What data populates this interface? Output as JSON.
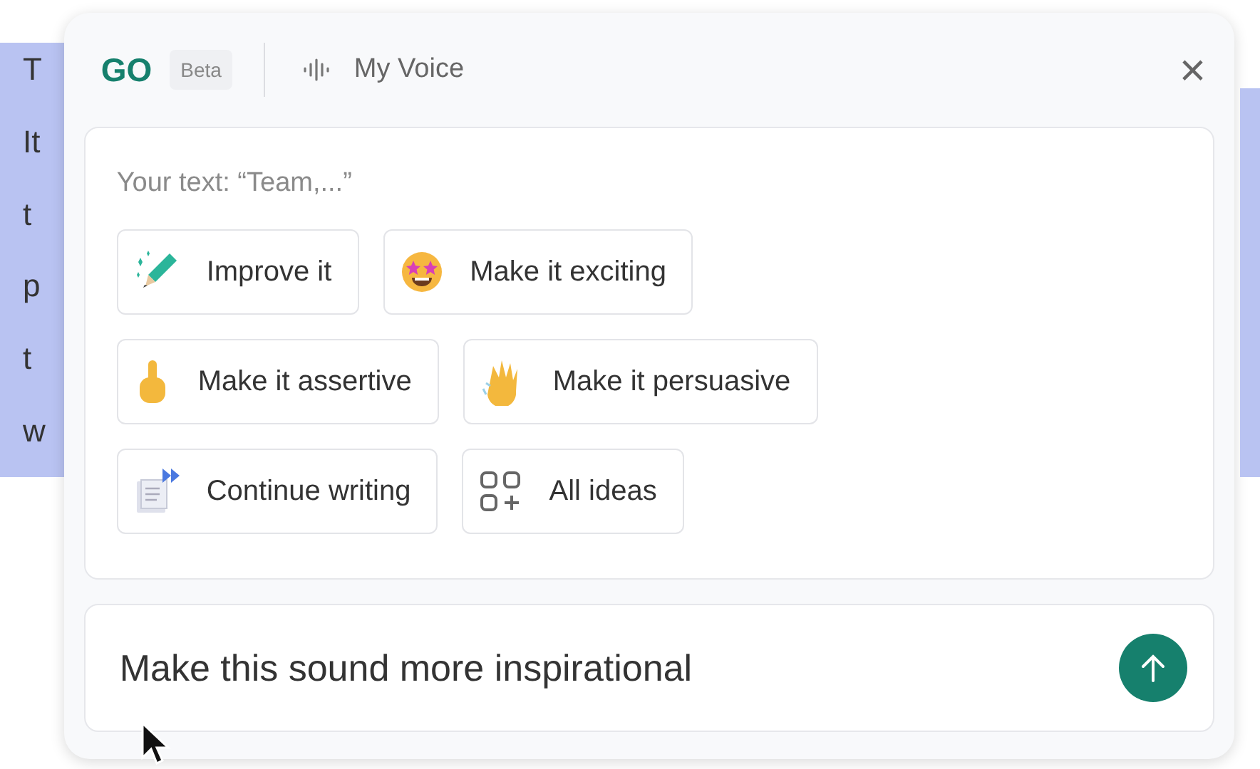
{
  "document": {
    "lines": [
      "T",
      "It",
      "t",
      "p",
      "t",
      "w"
    ]
  },
  "panel": {
    "logo": "GO",
    "badge": "Beta",
    "voice_label": "My Voice",
    "close": "×"
  },
  "context": "Your text: “Team,...”",
  "suggestions": [
    {
      "kind": "improve",
      "label": "Improve it"
    },
    {
      "kind": "exciting",
      "label": "Make it exciting"
    },
    {
      "kind": "assertive",
      "label": "Make it assertive"
    },
    {
      "kind": "persuasive",
      "label": "Make it persuasive"
    },
    {
      "kind": "continue",
      "label": "Continue writing"
    },
    {
      "kind": "ideas",
      "label": "All ideas"
    }
  ],
  "prompt": {
    "value": "Make this sound more inspirational"
  }
}
